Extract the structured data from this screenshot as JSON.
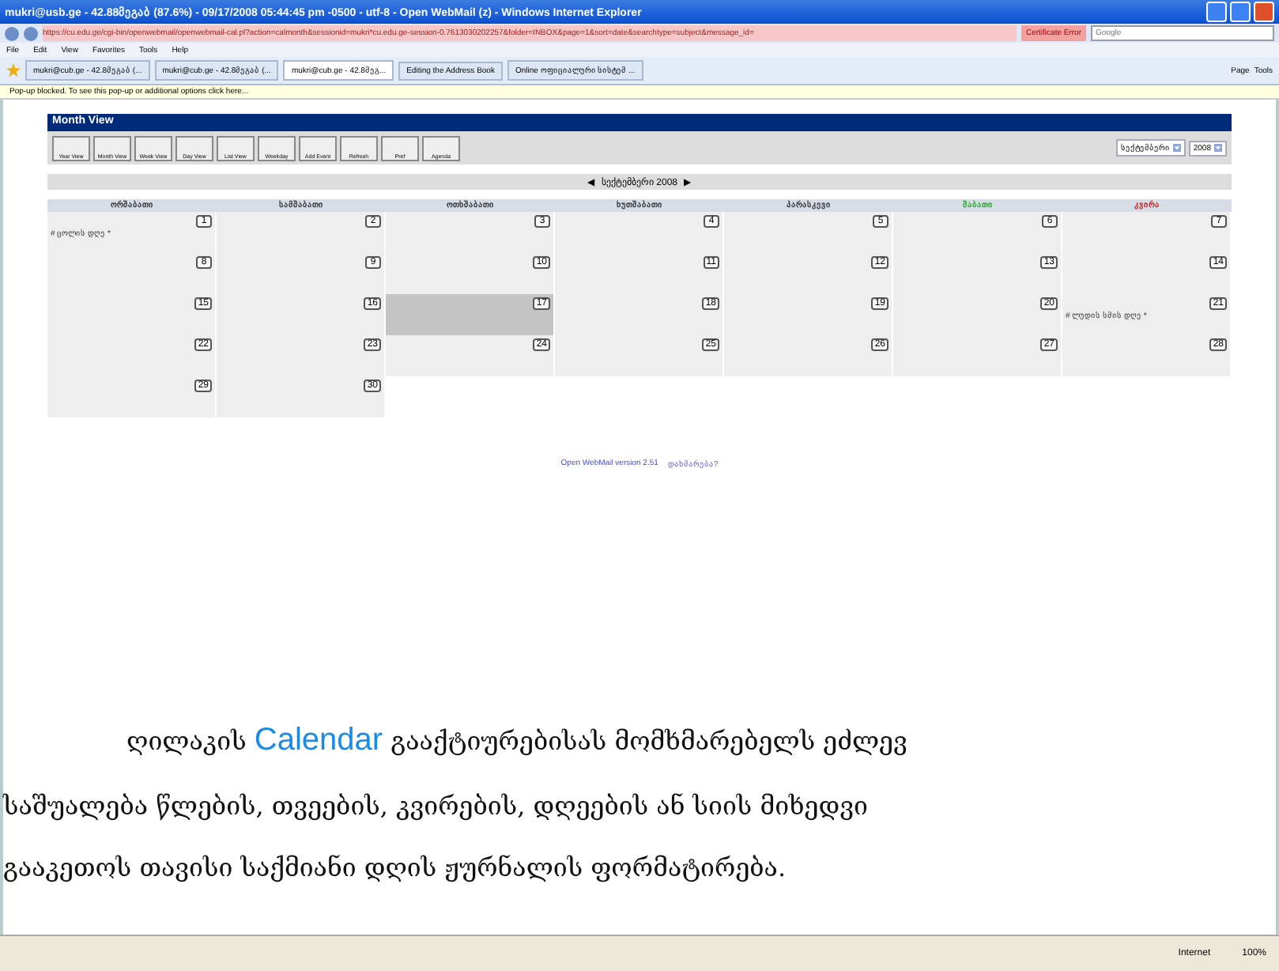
{
  "window": {
    "title": "mukri@usb.ge - 42.88მეგაბ (87.6%) - 09/17/2008 05:44:45 pm -0500 - utf-8 - Open WebMail (z) - Windows Internet Explorer"
  },
  "address_bar": {
    "url": "https://cu.edu.ge/cgi-bin/openwebmail/openwebmail-cal.pl?action=calmonth&sessionid=mukri*cu.edu.ge-session-0.7613030202257&folder=INBOX&page=1&sort=date&searchtype=subject&message_id=",
    "certificate": "Certificate Error",
    "search_placeholder": "Google"
  },
  "menu": [
    "File",
    "Edit",
    "View",
    "Favorites",
    "Tools",
    "Help"
  ],
  "tabs": [
    {
      "label": "mukri@cub.ge - 42.8მეგაბ (...",
      "selected": false
    },
    {
      "label": "mukri@cub.ge - 42.8მეგაბ (...",
      "selected": false
    },
    {
      "label": "mukri@cub.ge - 42.8მეგ...",
      "selected": true
    },
    {
      "label": "Editing the Address Book",
      "selected": false
    },
    {
      "label": "Online ოფიციალური სისტემ ...",
      "selected": false
    }
  ],
  "command_bar": [
    "Page",
    "Tools"
  ],
  "info_bar": "Pop-up blocked. To see this pop-up or additional options click here...",
  "calendar": {
    "title": "Month View",
    "tools": [
      "Year View",
      "Month View",
      "Week View",
      "Day View",
      "List View",
      "Weekday",
      "Add Event",
      "Refresh",
      "Pref",
      "Agenda"
    ],
    "month_select": "სექტემბერი",
    "year_select": "2008",
    "nav_prev": "◀",
    "nav_label": "სექტემბერი 2008",
    "nav_next": "▶",
    "weekdays": [
      {
        "label": "ორშაბათი",
        "color": "#333333"
      },
      {
        "label": "სამშაბათი",
        "color": "#333333"
      },
      {
        "label": "ოთხშაბათი",
        "color": "#333333"
      },
      {
        "label": "ხუთშაბათი",
        "color": "#333333"
      },
      {
        "label": "პარასკევი",
        "color": "#333333"
      },
      {
        "label": "შაბათი",
        "color": "#22aa22"
      },
      {
        "label": "კვირა",
        "color": "#cc2222"
      }
    ],
    "weeks": [
      [
        {
          "day": "1",
          "event": "# ცოლის დღე *",
          "selected": false
        },
        {
          "day": "2",
          "selected": false
        },
        {
          "day": "3",
          "selected": false
        },
        {
          "day": "4",
          "selected": false
        },
        {
          "day": "5",
          "selected": false
        },
        {
          "day": "6",
          "selected": false
        },
        {
          "day": "7",
          "selected": false
        }
      ],
      [
        {
          "day": "8",
          "selected": false
        },
        {
          "day": "9",
          "selected": false
        },
        {
          "day": "10",
          "selected": false
        },
        {
          "day": "11",
          "selected": false
        },
        {
          "day": "12",
          "selected": false
        },
        {
          "day": "13",
          "selected": false
        },
        {
          "day": "14",
          "selected": false
        }
      ],
      [
        {
          "day": "15",
          "selected": false
        },
        {
          "day": "16",
          "selected": false
        },
        {
          "day": "17",
          "selected": true
        },
        {
          "day": "18",
          "selected": false
        },
        {
          "day": "19",
          "selected": false
        },
        {
          "day": "20",
          "selected": false
        },
        {
          "day": "21",
          "event": "# ლუდის სმის დღე *",
          "selected": false
        }
      ],
      [
        {
          "day": "22",
          "selected": false
        },
        {
          "day": "23",
          "selected": false
        },
        {
          "day": "24",
          "selected": false
        },
        {
          "day": "25",
          "selected": false
        },
        {
          "day": "26",
          "selected": false
        },
        {
          "day": "27",
          "selected": false
        },
        {
          "day": "28",
          "selected": false
        }
      ],
      [
        {
          "day": "29",
          "selected": false
        },
        {
          "day": "30",
          "selected": false
        }
      ]
    ],
    "footer_version": "Open WebMail version 2.51",
    "footer_link": "დახმარება?"
  },
  "description": [
    "ღილაკის **Calendar** გააქტიურებისას მომხმარებელს ეძლევ",
    "საშუალება წლების, თვეების, კვირების, დღეების ან სიის მიხედვი",
    "გააკეთოს თავისი საქმიანი დღის ჟურნალის  ფორმატირება."
  ],
  "status_bar": {
    "zone": "Internet",
    "zoom": "100%"
  }
}
